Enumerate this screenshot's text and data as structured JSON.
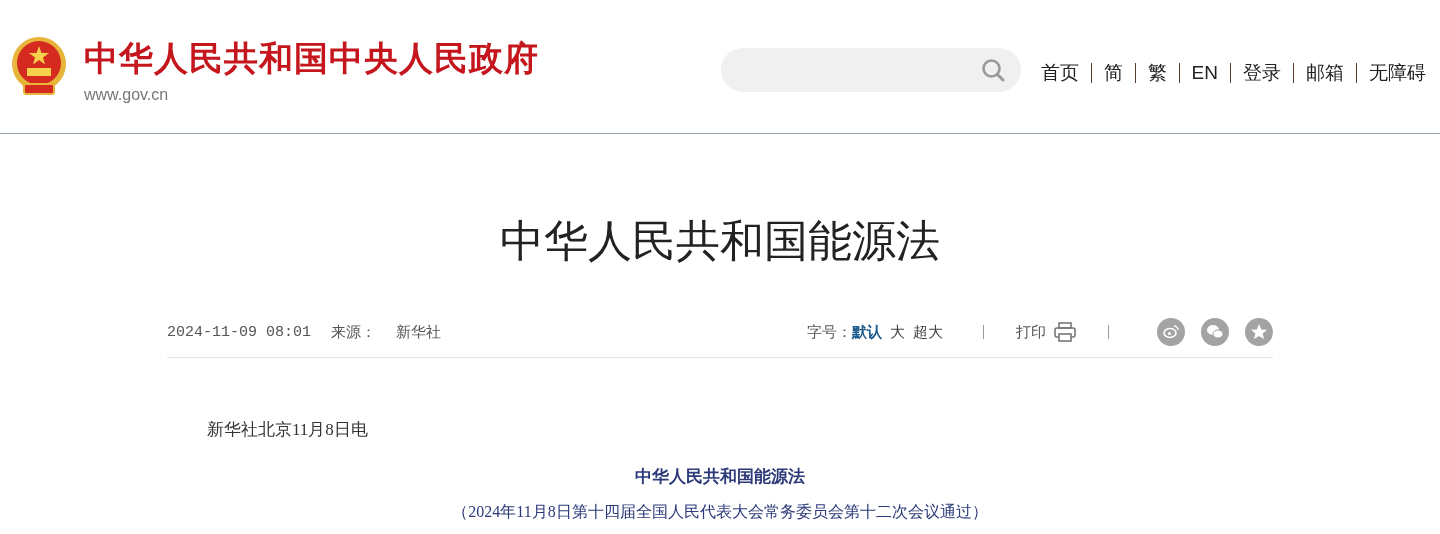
{
  "header": {
    "site_title": "中华人民共和国中央人民政府",
    "site_url": "www.gov.cn",
    "nav_links": [
      "首页",
      "简",
      "繁",
      "EN",
      "登录",
      "邮箱",
      "无障碍"
    ]
  },
  "article": {
    "title": "中华人民共和国能源法",
    "date": "2024-11-09 08:01",
    "source_label": "来源：",
    "source": "新华社",
    "font_size_label": "字号：",
    "font_sizes": [
      {
        "label": "默认",
        "selected": true
      },
      {
        "label": "大",
        "selected": false
      },
      {
        "label": "超大",
        "selected": false
      }
    ],
    "print_label": "打印",
    "share": [
      {
        "kind": "weibo"
      },
      {
        "kind": "wechat"
      },
      {
        "kind": "favorite"
      }
    ],
    "body": [
      {
        "kind": "lead",
        "text": "新华社北京11月8日电"
      },
      {
        "kind": "heading",
        "text": "中华人民共和国能源法"
      },
      {
        "kind": "note",
        "text": "（2024年11月8日第十四届全国人民代表大会常务委员会第十二次会议通过）"
      }
    ]
  }
}
